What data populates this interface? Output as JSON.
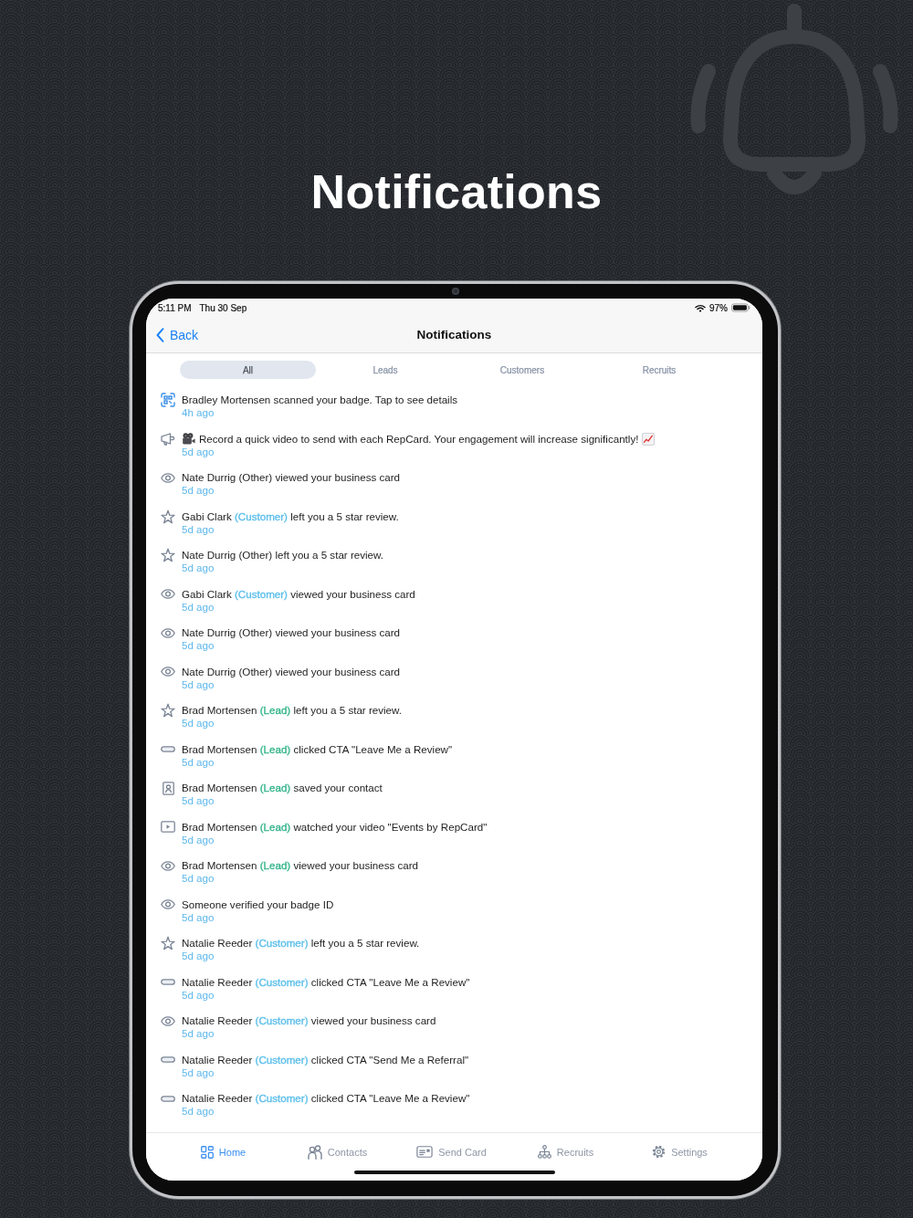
{
  "headline": "Notifications",
  "status_bar": {
    "time": "5:11 PM",
    "date": "Thu 30 Sep",
    "battery": "97%"
  },
  "nav_bar": {
    "back": "Back",
    "title": "Notifications"
  },
  "tabs": [
    {
      "label": "All",
      "selected": true
    },
    {
      "label": "Leads",
      "selected": false
    },
    {
      "label": "Customers",
      "selected": false
    },
    {
      "label": "Recruits",
      "selected": false
    }
  ],
  "notifications": [
    {
      "kind": "scan",
      "text": "Bradley Mortensen scanned your badge. Tap to see details",
      "time": "4h ago"
    },
    {
      "kind": "promo",
      "text": "Record a quick video to send with each RepCard. Your engagement will increase significantly!",
      "time": "5d ago"
    },
    {
      "kind": "view",
      "text": "Nate Durrig (Other) viewed your business card",
      "time": "5d ago"
    },
    {
      "kind": "star",
      "subject": "Gabi Clark",
      "tag": {
        "label": "(Customer)",
        "color": "#5dbfea"
      },
      "action": "left you a 5 star review.",
      "time": "5d ago"
    },
    {
      "kind": "star",
      "text": "Nate Durrig (Other) left you a 5 star review.",
      "time": "5d ago"
    },
    {
      "kind": "view",
      "subject": "Gabi Clark",
      "tag": {
        "label": "(Customer)",
        "color": "#5dbfea"
      },
      "action": "viewed your business card",
      "time": "5d ago"
    },
    {
      "kind": "view",
      "text": "Nate Durrig (Other) viewed your business card",
      "time": "5d ago"
    },
    {
      "kind": "view",
      "text": "Nate Durrig (Other) viewed your business card",
      "time": "5d ago"
    },
    {
      "kind": "star",
      "subject": "Brad Mortensen",
      "tag": {
        "label": "(Lead)",
        "color": "#36b58c"
      },
      "action": "left you a 5 star review.",
      "time": "5d ago"
    },
    {
      "kind": "cta",
      "subject": "Brad Mortensen",
      "tag": {
        "label": "(Lead)",
        "color": "#36b58c"
      },
      "action": "clicked CTA \"Leave Me a Review\"",
      "time": "5d ago"
    },
    {
      "kind": "contact",
      "subject": "Brad Mortensen",
      "tag": {
        "label": "(Lead)",
        "color": "#36b58c"
      },
      "action": "saved your contact",
      "time": "5d ago"
    },
    {
      "kind": "video",
      "subject": "Brad Mortensen",
      "tag": {
        "label": "(Lead)",
        "color": "#36b58c"
      },
      "action": "watched your video \"Events by RepCard\"",
      "time": "5d ago"
    },
    {
      "kind": "view",
      "subject": "Brad Mortensen",
      "tag": {
        "label": "(Lead)",
        "color": "#36b58c"
      },
      "action": "viewed your business card",
      "time": "5d ago"
    },
    {
      "kind": "view",
      "text": "Someone verified your badge ID",
      "time": "5d ago"
    },
    {
      "kind": "star",
      "subject": "Natalie Reeder",
      "tag": {
        "label": "(Customer)",
        "color": "#5dbfea"
      },
      "action": "left you a 5 star review.",
      "time": "5d ago"
    },
    {
      "kind": "cta",
      "subject": "Natalie Reeder",
      "tag": {
        "label": "(Customer)",
        "color": "#5dbfea"
      },
      "action": "clicked CTA \"Leave Me a Review\"",
      "time": "5d ago"
    },
    {
      "kind": "view",
      "subject": "Natalie Reeder",
      "tag": {
        "label": "(Customer)",
        "color": "#5dbfea"
      },
      "action": "viewed your business card",
      "time": "5d ago"
    },
    {
      "kind": "cta",
      "subject": "Natalie Reeder",
      "tag": {
        "label": "(Customer)",
        "color": "#5dbfea"
      },
      "action": "clicked CTA \"Send Me a Referral\"",
      "time": "5d ago"
    },
    {
      "kind": "cta",
      "subject": "Natalie Reeder",
      "tag": {
        "label": "(Customer)",
        "color": "#5dbfea"
      },
      "action": "clicked CTA \"Leave Me a Review\"",
      "time": "5d ago"
    }
  ],
  "tab_bar": [
    {
      "kind": "home",
      "label": "Home",
      "selected": true
    },
    {
      "kind": "contacts",
      "label": "Contacts",
      "selected": false
    },
    {
      "kind": "card",
      "label": "Send Card",
      "selected": false
    },
    {
      "kind": "recruits",
      "label": "Recruits",
      "selected": false
    },
    {
      "kind": "settings",
      "label": "Settings",
      "selected": false
    }
  ]
}
